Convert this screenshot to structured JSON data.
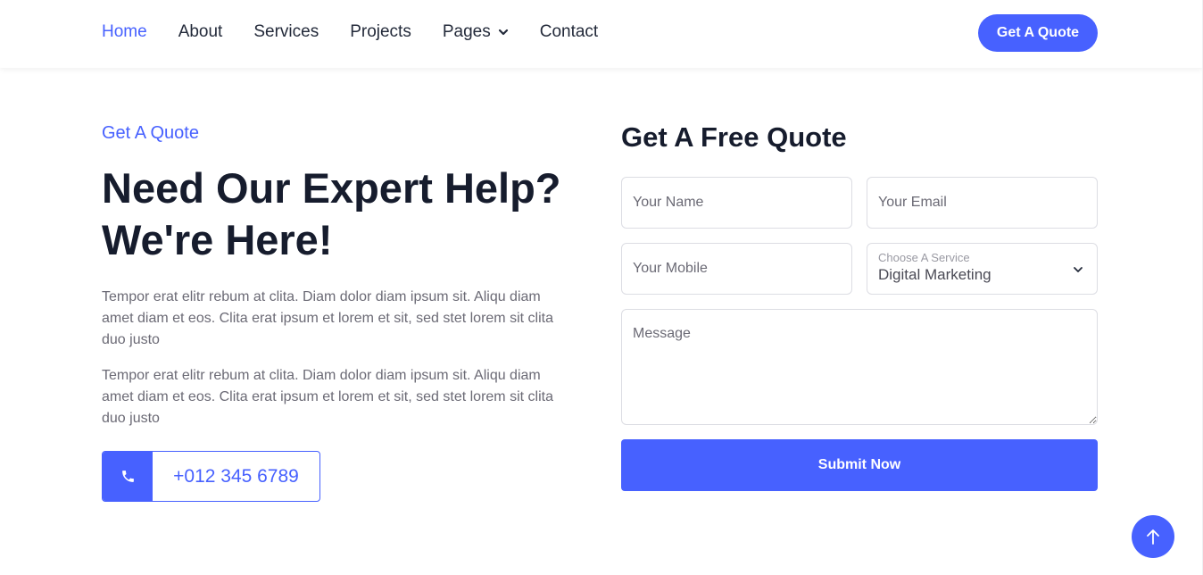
{
  "colors": {
    "accent": "#4761ff",
    "heading": "#161c2d",
    "text": "#6b6a75"
  },
  "nav": {
    "items": [
      {
        "label": "Home",
        "active": true
      },
      {
        "label": "About"
      },
      {
        "label": "Services"
      },
      {
        "label": "Projects"
      },
      {
        "label": "Pages",
        "has_dropdown": true
      },
      {
        "label": "Contact"
      }
    ],
    "cta_label": "Get A Quote"
  },
  "intro": {
    "eyebrow": "Get A Quote",
    "headline": "Need Our Expert Help? We're Here!",
    "paragraphs": [
      "Tempor erat elitr rebum at clita. Diam dolor diam ipsum sit. Aliqu diam amet diam et eos. Clita erat ipsum et lorem et sit, sed stet lorem sit clita duo justo",
      "Tempor erat elitr rebum at clita. Diam dolor diam ipsum sit. Aliqu diam amet diam et eos. Clita erat ipsum et lorem et sit, sed stet lorem sit clita duo justo"
    ],
    "phone_icon": "phone-icon",
    "phone": "+012 345 6789"
  },
  "form": {
    "title": "Get A Free Quote",
    "name_placeholder": "Your Name",
    "email_placeholder": "Your Email",
    "mobile_placeholder": "Your Mobile",
    "service_label": "Choose A Service",
    "service_value": "Digital Marketing",
    "message_placeholder": "Message",
    "submit_label": "Submit Now"
  },
  "back_to_top_icon": "arrow-up-icon"
}
